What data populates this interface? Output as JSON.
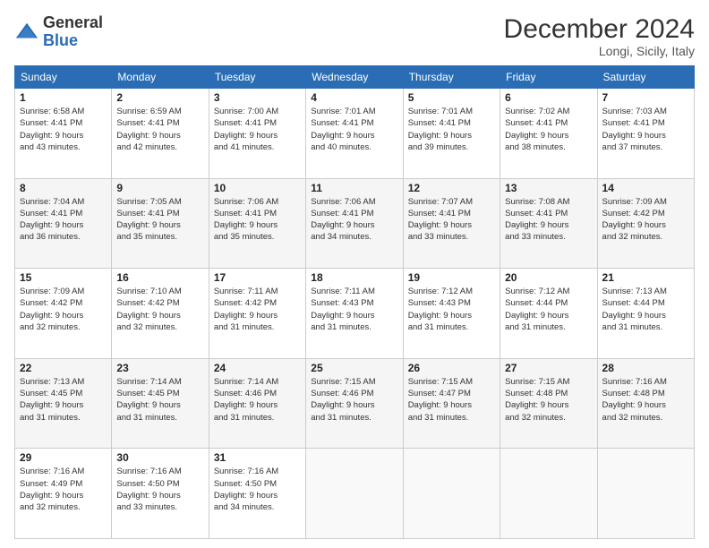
{
  "header": {
    "logo_general": "General",
    "logo_blue": "Blue",
    "month_title": "December 2024",
    "location": "Longi, Sicily, Italy"
  },
  "weekdays": [
    "Sunday",
    "Monday",
    "Tuesday",
    "Wednesday",
    "Thursday",
    "Friday",
    "Saturday"
  ],
  "weeks": [
    [
      {
        "day": "1",
        "rise": "6:58 AM",
        "set": "4:41 PM",
        "hours": "9 hours",
        "mins": "43 minutes."
      },
      {
        "day": "2",
        "rise": "6:59 AM",
        "set": "4:41 PM",
        "hours": "9 hours",
        "mins": "42 minutes."
      },
      {
        "day": "3",
        "rise": "7:00 AM",
        "set": "4:41 PM",
        "hours": "9 hours",
        "mins": "41 minutes."
      },
      {
        "day": "4",
        "rise": "7:01 AM",
        "set": "4:41 PM",
        "hours": "9 hours",
        "mins": "40 minutes."
      },
      {
        "day": "5",
        "rise": "7:01 AM",
        "set": "4:41 PM",
        "hours": "9 hours",
        "mins": "39 minutes."
      },
      {
        "day": "6",
        "rise": "7:02 AM",
        "set": "4:41 PM",
        "hours": "9 hours",
        "mins": "38 minutes."
      },
      {
        "day": "7",
        "rise": "7:03 AM",
        "set": "4:41 PM",
        "hours": "9 hours",
        "mins": "37 minutes."
      }
    ],
    [
      {
        "day": "8",
        "rise": "7:04 AM",
        "set": "4:41 PM",
        "hours": "9 hours",
        "mins": "36 minutes."
      },
      {
        "day": "9",
        "rise": "7:05 AM",
        "set": "4:41 PM",
        "hours": "9 hours",
        "mins": "35 minutes."
      },
      {
        "day": "10",
        "rise": "7:06 AM",
        "set": "4:41 PM",
        "hours": "9 hours",
        "mins": "35 minutes."
      },
      {
        "day": "11",
        "rise": "7:06 AM",
        "set": "4:41 PM",
        "hours": "9 hours",
        "mins": "34 minutes."
      },
      {
        "day": "12",
        "rise": "7:07 AM",
        "set": "4:41 PM",
        "hours": "9 hours",
        "mins": "33 minutes."
      },
      {
        "day": "13",
        "rise": "7:08 AM",
        "set": "4:41 PM",
        "hours": "9 hours",
        "mins": "33 minutes."
      },
      {
        "day": "14",
        "rise": "7:09 AM",
        "set": "4:42 PM",
        "hours": "9 hours",
        "mins": "32 minutes."
      }
    ],
    [
      {
        "day": "15",
        "rise": "7:09 AM",
        "set": "4:42 PM",
        "hours": "9 hours",
        "mins": "32 minutes."
      },
      {
        "day": "16",
        "rise": "7:10 AM",
        "set": "4:42 PM",
        "hours": "9 hours",
        "mins": "32 minutes."
      },
      {
        "day": "17",
        "rise": "7:11 AM",
        "set": "4:42 PM",
        "hours": "9 hours",
        "mins": "31 minutes."
      },
      {
        "day": "18",
        "rise": "7:11 AM",
        "set": "4:43 PM",
        "hours": "9 hours",
        "mins": "31 minutes."
      },
      {
        "day": "19",
        "rise": "7:12 AM",
        "set": "4:43 PM",
        "hours": "9 hours",
        "mins": "31 minutes."
      },
      {
        "day": "20",
        "rise": "7:12 AM",
        "set": "4:44 PM",
        "hours": "9 hours",
        "mins": "31 minutes."
      },
      {
        "day": "21",
        "rise": "7:13 AM",
        "set": "4:44 PM",
        "hours": "9 hours",
        "mins": "31 minutes."
      }
    ],
    [
      {
        "day": "22",
        "rise": "7:13 AM",
        "set": "4:45 PM",
        "hours": "9 hours",
        "mins": "31 minutes."
      },
      {
        "day": "23",
        "rise": "7:14 AM",
        "set": "4:45 PM",
        "hours": "9 hours",
        "mins": "31 minutes."
      },
      {
        "day": "24",
        "rise": "7:14 AM",
        "set": "4:46 PM",
        "hours": "9 hours",
        "mins": "31 minutes."
      },
      {
        "day": "25",
        "rise": "7:15 AM",
        "set": "4:46 PM",
        "hours": "9 hours",
        "mins": "31 minutes."
      },
      {
        "day": "26",
        "rise": "7:15 AM",
        "set": "4:47 PM",
        "hours": "9 hours",
        "mins": "31 minutes."
      },
      {
        "day": "27",
        "rise": "7:15 AM",
        "set": "4:48 PM",
        "hours": "9 hours",
        "mins": "32 minutes."
      },
      {
        "day": "28",
        "rise": "7:16 AM",
        "set": "4:48 PM",
        "hours": "9 hours",
        "mins": "32 minutes."
      }
    ],
    [
      {
        "day": "29",
        "rise": "7:16 AM",
        "set": "4:49 PM",
        "hours": "9 hours",
        "mins": "32 minutes."
      },
      {
        "day": "30",
        "rise": "7:16 AM",
        "set": "4:50 PM",
        "hours": "9 hours",
        "mins": "33 minutes."
      },
      {
        "day": "31",
        "rise": "7:16 AM",
        "set": "4:50 PM",
        "hours": "9 hours",
        "mins": "34 minutes."
      },
      null,
      null,
      null,
      null
    ]
  ],
  "labels": {
    "sunrise": "Sunrise:",
    "sunset": "Sunset:",
    "daylight": "Daylight:"
  }
}
